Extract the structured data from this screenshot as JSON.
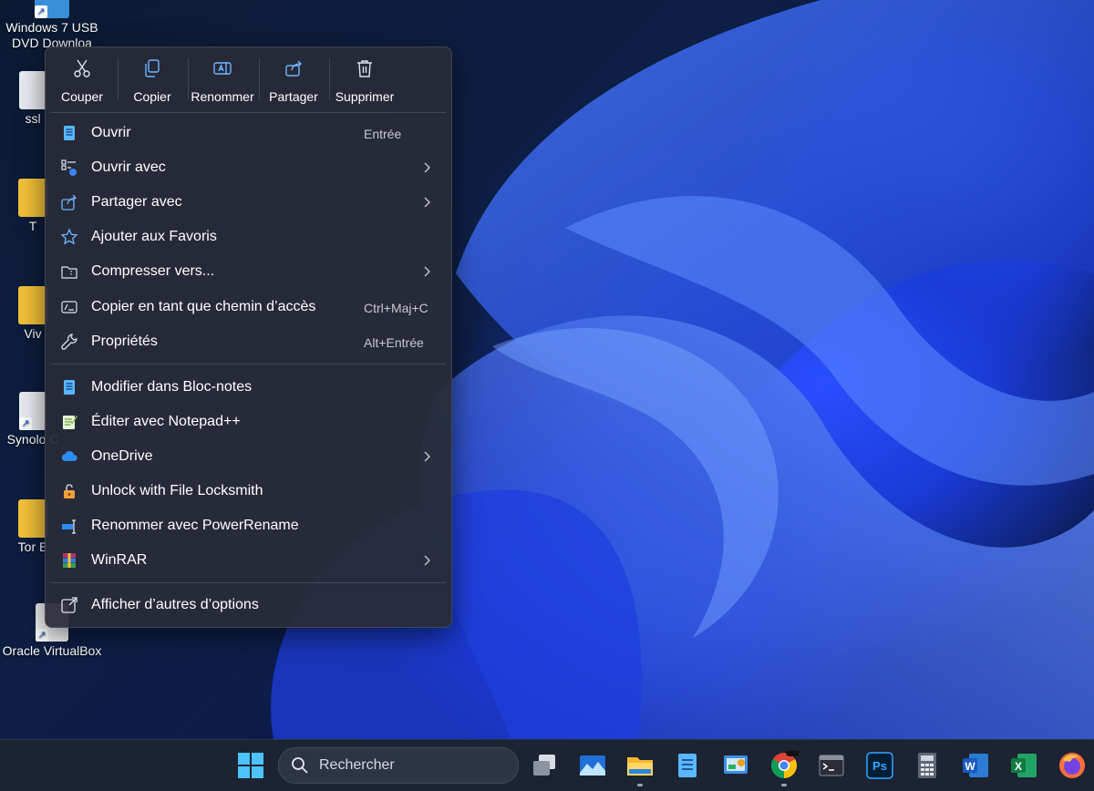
{
  "desktop": {
    "icons": [
      {
        "label": "Windows 7 USB DVD Downloa"
      },
      {
        "label": "ssl"
      },
      {
        "label": "T"
      },
      {
        "label": "Viv"
      },
      {
        "label": "Synolo C"
      },
      {
        "label": "Tor B"
      },
      {
        "label": "Oracle VirtualBox"
      }
    ]
  },
  "context_menu": {
    "quick_actions": [
      {
        "label": "Couper",
        "icon": "scissors-icon"
      },
      {
        "label": "Copier",
        "icon": "copy-icon"
      },
      {
        "label": "Renommer",
        "icon": "rename-icon"
      },
      {
        "label": "Partager",
        "icon": "share-icon"
      },
      {
        "label": "Supprimer",
        "icon": "trash-icon"
      }
    ],
    "items": [
      {
        "label": "Ouvrir",
        "shortcut": "Entrée",
        "icon": "notepad-icon",
        "submenu": false
      },
      {
        "label": "Ouvrir avec",
        "shortcut": "",
        "icon": "open-with-icon",
        "submenu": true
      },
      {
        "label": "Partager avec",
        "shortcut": "",
        "icon": "share-icon",
        "submenu": true
      },
      {
        "label": "Ajouter aux Favoris",
        "shortcut": "",
        "icon": "star-icon",
        "submenu": false
      },
      {
        "label": "Compresser vers...",
        "shortcut": "",
        "icon": "zip-folder-icon",
        "submenu": true
      },
      {
        "label": "Copier en tant que chemin d’accès",
        "shortcut": "Ctrl+Maj+C",
        "icon": "copy-path-icon",
        "submenu": false
      },
      {
        "label": "Propriétés",
        "shortcut": "Alt+Entrée",
        "icon": "wrench-icon",
        "submenu": false
      },
      {
        "label": "Modifier dans Bloc-notes",
        "shortcut": "",
        "icon": "notepad-icon",
        "submenu": false
      },
      {
        "label": "Éditer avec Notepad++",
        "shortcut": "",
        "icon": "notepadpp-icon",
        "submenu": false
      },
      {
        "label": "OneDrive",
        "shortcut": "",
        "icon": "cloud-icon",
        "submenu": true
      },
      {
        "label": "Unlock with File Locksmith",
        "shortcut": "",
        "icon": "lock-icon",
        "submenu": false
      },
      {
        "label": "Renommer avec PowerRename",
        "shortcut": "",
        "icon": "powerrename-icon",
        "submenu": false
      },
      {
        "label": "WinRAR",
        "shortcut": "",
        "icon": "winrar-icon",
        "submenu": true
      },
      {
        "label": "Afficher d’autres d’options",
        "shortcut": "",
        "icon": "more-options-icon",
        "submenu": false
      }
    ]
  },
  "taskbar": {
    "search_placeholder": "Rechercher",
    "apps": [
      {
        "icon": "start-icon"
      },
      {
        "icon": "task-view-icon"
      },
      {
        "icon": "photos-icon"
      },
      {
        "icon": "file-explorer-icon",
        "running": true
      },
      {
        "icon": "notepad-icon"
      },
      {
        "icon": "control-panel-icon"
      },
      {
        "icon": "chrome-icon",
        "running": true
      },
      {
        "icon": "terminal-icon"
      },
      {
        "icon": "photoshop-icon",
        "text": "Ps"
      },
      {
        "icon": "calculator-icon"
      },
      {
        "icon": "word-icon",
        "text": "W"
      },
      {
        "icon": "excel-icon",
        "text": "X"
      },
      {
        "icon": "firefox-icon"
      }
    ]
  },
  "colors": {
    "accent": "#3b82f6",
    "menu_bg": "#282c38",
    "taskbar_bg": "#1c2333"
  }
}
